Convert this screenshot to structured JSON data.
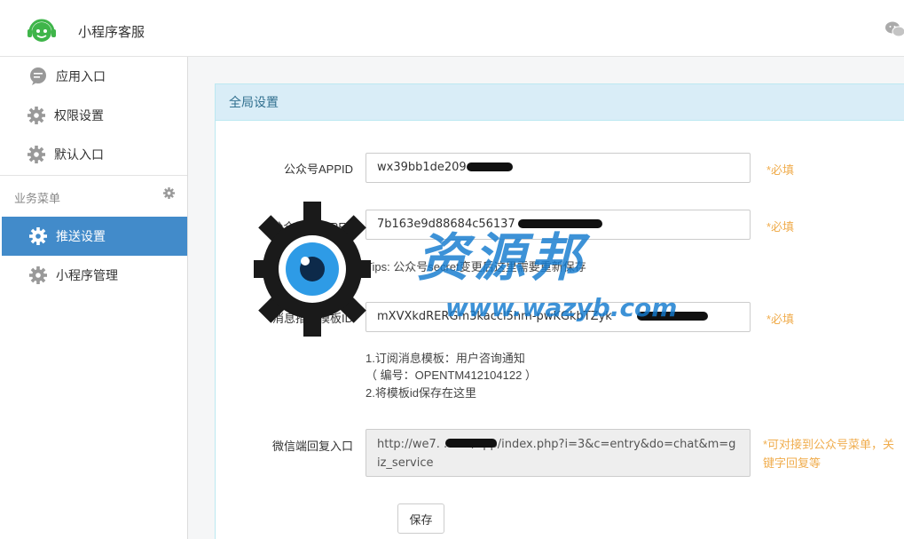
{
  "app": {
    "title": "小程序客服",
    "logo_icon": "headset-logo-icon",
    "header_icon": "wechat-icon"
  },
  "sidebar": {
    "top_items": [
      {
        "label": "应用入口",
        "icon": "chat-bubble-icon"
      },
      {
        "label": "权限设置",
        "icon": "gear-icon"
      },
      {
        "label": "默认入口",
        "icon": "gear-icon"
      }
    ],
    "section": {
      "label": "业务菜单",
      "icon": "gear-icon"
    },
    "business_items": [
      {
        "label": "推送设置",
        "icon": "gear-icon",
        "active": true
      },
      {
        "label": "小程序管理",
        "icon": "gear-icon",
        "active": false
      }
    ]
  },
  "panel": {
    "title": "全局设置",
    "fields": [
      {
        "label": "公众号APPID",
        "value": "wx39bb1de209",
        "hint": "*必填"
      },
      {
        "label": "公众号SECRET",
        "value": "7b163e9d88684c56137",
        "hint": "*必填",
        "tip": "Tips: 公众号secret变更后这里需要重新保存"
      },
      {
        "label": "消息推送模板ID",
        "value": "mXVXkdRERGm3kaccl5hm-pwKGkbTZyk",
        "hint": "*必填",
        "help": [
          "1.订阅消息模板：用户咨询通知",
          "（ 编号：OPENTM412104122 ）",
          "2.将模板id保存在这里"
        ]
      },
      {
        "label": "微信端回复入口",
        "value": "http://we7.        .com/app/index.php?i=3&c=entry&do=chat&m=giz_service",
        "hint": "*可对接到公众号菜单，关键字回复等"
      }
    ],
    "save_label": "保存"
  },
  "watermark": {
    "text": "资源邦",
    "url": "www.wazyb.com"
  },
  "colors": {
    "accent": "#428bca",
    "panel_head": "#d9edf7",
    "panel_head_text": "#31708f",
    "required": "#f0ad4e",
    "watermark": "#127ace"
  }
}
